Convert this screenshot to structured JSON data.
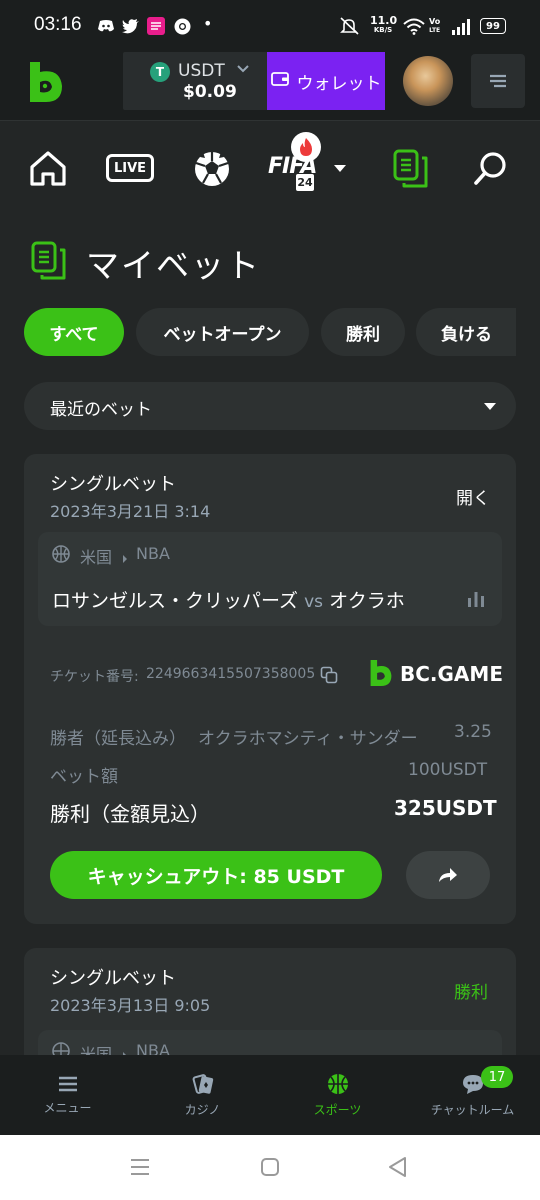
{
  "status_bar": {
    "time": "03:16",
    "net_speed_value": "11.0",
    "net_speed_unit": "KB/S",
    "volte_top": "Vo",
    "volte_bottom": "LTE",
    "battery": "99",
    "dot": "•"
  },
  "header": {
    "currency": "USDT",
    "balance": "$0.09",
    "wallet_label": "ウォレット"
  },
  "main_nav": {
    "live_label": "LIVE",
    "fifa_label": "FIFA",
    "fifa_year": "24"
  },
  "page": {
    "title": "マイベット"
  },
  "filters": [
    "すべて",
    "ベットオープン",
    "勝利",
    "負ける"
  ],
  "recent_select": {
    "value": "最近のベット"
  },
  "bets": [
    {
      "type": "シングルベット",
      "date": "2023年3月21日 3:14",
      "status": "開く",
      "league_country": "米国",
      "league": "NBA",
      "team_home": "ロサンゼルス・クリッパーズ",
      "vs": "vs",
      "team_away": "オクラホ",
      "ticket_label": "チケット番号:",
      "ticket_number": "2249663415507358005",
      "brand": "BC.GAME",
      "market": "勝者（延長込み）",
      "selection": "オクラホマシティ・サンダー",
      "odds": "3.25",
      "stake_label": "ベット額",
      "stake": "100USDT",
      "payout_label": "勝利（金額見込）",
      "payout": "325USDT",
      "cashout_label": "キャッシュアウト: 85 USDT"
    },
    {
      "type": "シングルベット",
      "date": "2023年3月13日 9:05",
      "status": "勝利",
      "league_country": "米国",
      "league": "NBA"
    }
  ],
  "bottom_nav": [
    {
      "label": "メニュー",
      "icon": "menu-icon"
    },
    {
      "label": "カジノ",
      "icon": "casino-icon"
    },
    {
      "label": "スポーツ",
      "icon": "basketball-icon"
    },
    {
      "label": "チャットルーム",
      "icon": "chat-icon",
      "badge": "17"
    }
  ],
  "colors": {
    "accent_green": "#3bc117",
    "wallet_purple": "#7b22f2",
    "background": "#232626",
    "card": "#2d3131"
  }
}
